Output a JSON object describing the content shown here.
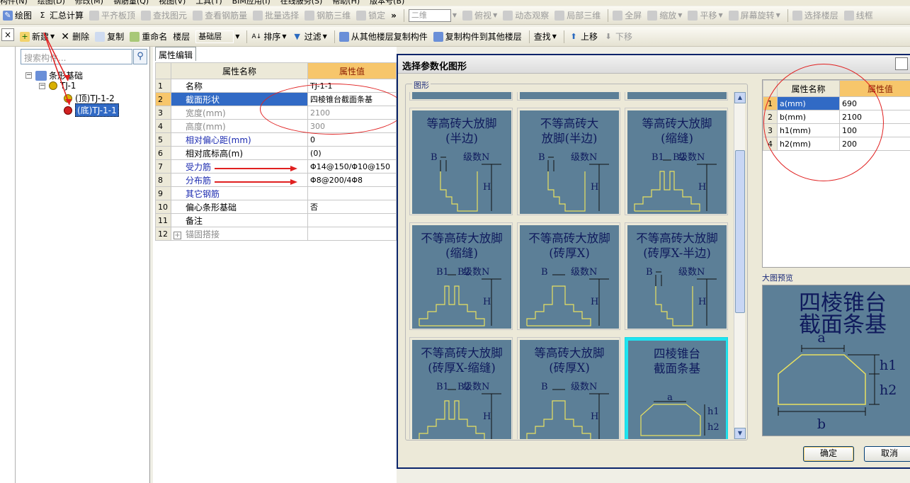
{
  "menu": [
    "构件(N)",
    "绘图(D)",
    "修改(M)",
    "钢筋量(Q)",
    "视图(V)",
    "工具(T)",
    "BIM应用(I)",
    "在线服务(S)",
    "帮助(H)",
    "版本号(B)"
  ],
  "toolbar1": {
    "draw": "绘图",
    "sum": "汇总计算",
    "flat": "平齐板顶",
    "find": "查找图元",
    "view_qty": "查看钢筋量",
    "batch": "批量选择",
    "rebar3d": "钢筋三维",
    "lock": "锁定",
    "view2d": "二维",
    "top_view": "俯视",
    "dynamic": "动态观察",
    "local3d": "局部三维",
    "fullscreen": "全屏",
    "zoom": "缩放",
    "pan": "平移",
    "rotate": "屏幕旋转",
    "select_floor": "选择楼层",
    "wireframe": "线框"
  },
  "toolbar2": {
    "new": "新建",
    "delete": "删除",
    "copy": "复制",
    "rename": "重命名",
    "floor_label": "楼层",
    "floor_value": "基础层",
    "sort": "排序",
    "filter": "过滤",
    "copy_from": "从其他楼层复制构件",
    "copy_to": "复制构件到其他楼层",
    "find": "查找",
    "up": "上移",
    "down": "下移"
  },
  "left_strip_close": "×",
  "tree": {
    "search_placeholder": "搜索构件...",
    "root": "条形基础",
    "child": "TJ-1",
    "leaf1": "(顶)TJ-1-2",
    "leaf2": "(底)TJ-1-1"
  },
  "props": {
    "tab": "属性编辑",
    "col_name": "属性名称",
    "col_value": "属性值",
    "rows": [
      {
        "n": "1",
        "name": "名称",
        "value": "TJ-1-1",
        "style": ""
      },
      {
        "n": "2",
        "name": "截面形状",
        "value": "四棱锥台截面条基",
        "style": "sel"
      },
      {
        "n": "3",
        "name": "宽度(mm)",
        "value": "2100",
        "style": "gray"
      },
      {
        "n": "4",
        "name": "高度(mm)",
        "value": "300",
        "style": "gray"
      },
      {
        "n": "5",
        "name": "相对偏心距(mm)",
        "value": "0",
        "style": "blue"
      },
      {
        "n": "6",
        "name": "相对底标高(m)",
        "value": "(0)",
        "style": ""
      },
      {
        "n": "7",
        "name": "受力筋",
        "value": "Φ14@150/Φ10@150",
        "style": "blue"
      },
      {
        "n": "8",
        "name": "分布筋",
        "value": "Φ8@200/4Φ8",
        "style": "blue"
      },
      {
        "n": "9",
        "name": "其它钢筋",
        "value": "",
        "style": "blue"
      },
      {
        "n": "10",
        "name": "偏心条形基础",
        "value": "否",
        "style": ""
      },
      {
        "n": "11",
        "name": "备注",
        "value": "",
        "style": ""
      },
      {
        "n": "12",
        "name": "锚固搭接",
        "value": "",
        "style": "gray"
      }
    ],
    "expander": "+"
  },
  "dialog": {
    "title": "选择参数化图形",
    "shapes_group": "图形",
    "tiles": [
      {
        "title": "等高砖大放脚\n(半边)",
        "type": "half"
      },
      {
        "title": "不等高砖大\n放脚(半边)",
        "type": "half"
      },
      {
        "title": "等高砖大放脚\n(缩缝)",
        "type": "gap"
      },
      {
        "title": "不等高砖大放脚\n(缩缝)",
        "type": "gap"
      },
      {
        "title": "不等高砖大放脚\n(砖厚X)",
        "type": "full"
      },
      {
        "title": "不等高砖大放脚\n(砖厚X-半边)",
        "type": "half"
      },
      {
        "title": "不等高砖大放脚\n(砖厚X-缩缝)",
        "type": "gap"
      },
      {
        "title": "等高砖大放脚\n(砖厚X)",
        "type": "full"
      },
      {
        "title": "四棱锥台\n截面条基",
        "type": "trap",
        "selected": true
      }
    ],
    "tile_labels": {
      "b": "B",
      "b1": "B1",
      "b2": "B2",
      "n": "级数N",
      "h": "H"
    },
    "param_col_name": "属性名称",
    "param_col_value": "属性值",
    "params": [
      {
        "n": "1",
        "name": "a(mm)",
        "value": "690"
      },
      {
        "n": "2",
        "name": "b(mm)",
        "value": "2100"
      },
      {
        "n": "3",
        "name": "h1(mm)",
        "value": "100"
      },
      {
        "n": "4",
        "name": "h2(mm)",
        "value": "200"
      }
    ],
    "preview_label": "大图预览",
    "preview_title": "四棱锥台\n截面条基",
    "preview_labels": {
      "a": "a",
      "b": "b",
      "h1": "h1",
      "h2": "h2"
    },
    "ok": "确定",
    "cancel": "取消"
  },
  "colors": {
    "annotation": "#e02020",
    "tile_bg": "#5c7f97",
    "tile_line": "#e8e060",
    "selected_border": "#1fe4ef",
    "header_value": "#f7c66b"
  }
}
